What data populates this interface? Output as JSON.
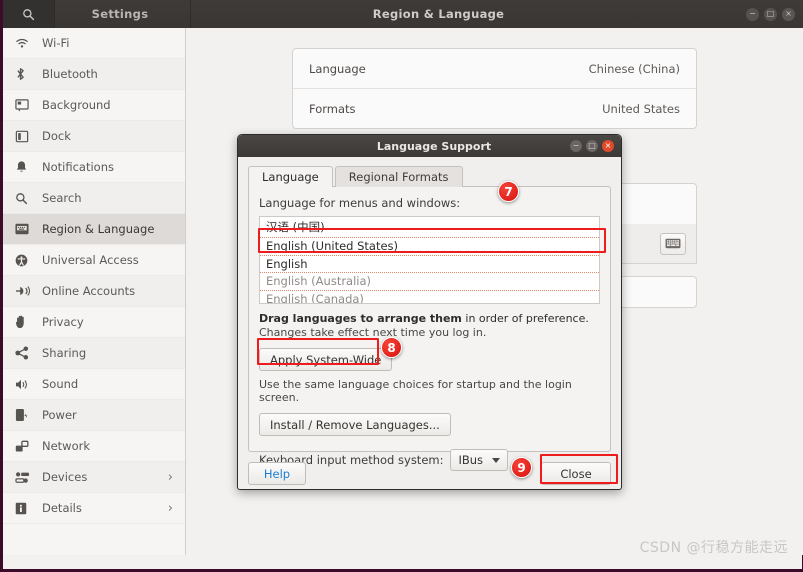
{
  "window": {
    "search_icon": "search-icon",
    "settings_title": "Settings",
    "main_title": "Region & Language",
    "controls": {
      "minimize": "−",
      "maximize": "□",
      "close": "×"
    }
  },
  "sidebar": {
    "items": [
      {
        "label": "Wi-Fi",
        "icon": "wifi-icon",
        "selected": false,
        "chevron": ""
      },
      {
        "label": "Bluetooth",
        "icon": "bluetooth-icon",
        "selected": false,
        "chevron": ""
      },
      {
        "label": "Background",
        "icon": "background-icon",
        "selected": false,
        "chevron": ""
      },
      {
        "label": "Dock",
        "icon": "dock-icon",
        "selected": false,
        "chevron": ""
      },
      {
        "label": "Notifications",
        "icon": "bell-icon",
        "selected": false,
        "chevron": ""
      },
      {
        "label": "Search",
        "icon": "search-icon",
        "selected": false,
        "chevron": ""
      },
      {
        "label": "Region & Language",
        "icon": "region-language-icon",
        "selected": true,
        "chevron": ""
      },
      {
        "label": "Universal Access",
        "icon": "universal-access-icon",
        "selected": false,
        "chevron": ""
      },
      {
        "label": "Online Accounts",
        "icon": "online-accounts-icon",
        "selected": false,
        "chevron": ""
      },
      {
        "label": "Privacy",
        "icon": "privacy-hand-icon",
        "selected": false,
        "chevron": ""
      },
      {
        "label": "Sharing",
        "icon": "sharing-icon",
        "selected": false,
        "chevron": ""
      },
      {
        "label": "Sound",
        "icon": "sound-icon",
        "selected": false,
        "chevron": ""
      },
      {
        "label": "Power",
        "icon": "power-battery-icon",
        "selected": false,
        "chevron": ""
      },
      {
        "label": "Network",
        "icon": "network-icon",
        "selected": false,
        "chevron": ""
      },
      {
        "label": "Devices",
        "icon": "devices-icon",
        "selected": false,
        "chevron": "›"
      },
      {
        "label": "Details",
        "icon": "details-info-icon",
        "selected": false,
        "chevron": "›"
      }
    ]
  },
  "main": {
    "rows": [
      {
        "label": "Language",
        "value": "Chinese (China)"
      },
      {
        "label": "Formats",
        "value": "United States"
      }
    ],
    "keyboard_icon": "keyboard-icon"
  },
  "dialog": {
    "title": "Language Support",
    "controls": {
      "minimize": "−",
      "maximize": "□",
      "close": "×"
    },
    "tabs": [
      {
        "label": "Language",
        "active": true
      },
      {
        "label": "Regional Formats",
        "active": false
      }
    ],
    "field_label": "Language for menus and windows:",
    "languages": [
      {
        "label": "汉语 (中国)",
        "dim": false,
        "highlighted": true
      },
      {
        "label": "English (United States)",
        "dim": false,
        "highlighted": false
      },
      {
        "label": "English",
        "dim": false,
        "highlighted": false
      },
      {
        "label": "English (Australia)",
        "dim": true,
        "highlighted": false
      },
      {
        "label": "English (Canada)",
        "dim": true,
        "highlighted": false
      }
    ],
    "hint_bold": "Drag languages to arrange them",
    "hint_bold_tail": " in order of preference.",
    "hint_sub": "Changes take effect next time you log in.",
    "apply_button": "Apply System-Wide",
    "apply_desc": "Use the same language choices for startup and the login screen.",
    "install_button": "Install / Remove Languages...",
    "keyboard_label": "Keyboard input method system:",
    "keyboard_value": "IBus",
    "help_button": "Help",
    "close_button": "Close"
  },
  "badges": [
    {
      "number": "7"
    },
    {
      "number": "8"
    },
    {
      "number": "9"
    }
  ],
  "watermark": "CSDN @行稳方能走远",
  "colors": {
    "accent_red": "#ee1c1c",
    "titlebar": "#3b3836",
    "sidebar_selected": "#dedad7",
    "link_blue": "#1a7fd4"
  }
}
